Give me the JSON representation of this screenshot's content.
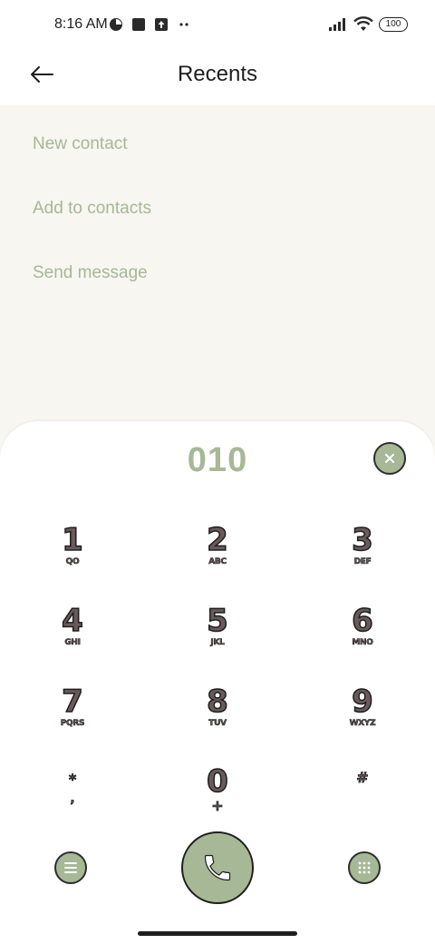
{
  "status_bar": {
    "time": "8:16 AM",
    "icons_left": [
      "pie-icon",
      "square-icon",
      "upload-icon",
      "more-dots-icon"
    ],
    "icons_right": [
      "signal-icon",
      "wifi-icon"
    ],
    "battery": "100"
  },
  "header": {
    "title": "Recents",
    "back_icon": "arrow-left-icon"
  },
  "actions": [
    {
      "label": "New contact"
    },
    {
      "label": "Add to contacts"
    },
    {
      "label": "Send message"
    }
  ],
  "dialpad": {
    "number": "010",
    "keys": [
      {
        "digit": "1",
        "letters": "QO"
      },
      {
        "digit": "2",
        "letters": "ABC"
      },
      {
        "digit": "3",
        "letters": "DEF"
      },
      {
        "digit": "4",
        "letters": "GHI"
      },
      {
        "digit": "5",
        "letters": "JKL"
      },
      {
        "digit": "6",
        "letters": "MNO"
      },
      {
        "digit": "7",
        "letters": "PQRS"
      },
      {
        "digit": "8",
        "letters": "TUV"
      },
      {
        "digit": "9",
        "letters": "WXYZ"
      },
      {
        "digit": "*",
        "letters": ","
      },
      {
        "digit": "0",
        "letters": "+"
      },
      {
        "digit": "#",
        "letters": ""
      }
    ]
  },
  "colors": {
    "accent": "#a6b896",
    "surface": "#f7f6f0",
    "key_fill": "#6a5a5a",
    "outline": "#1e1e1e"
  }
}
